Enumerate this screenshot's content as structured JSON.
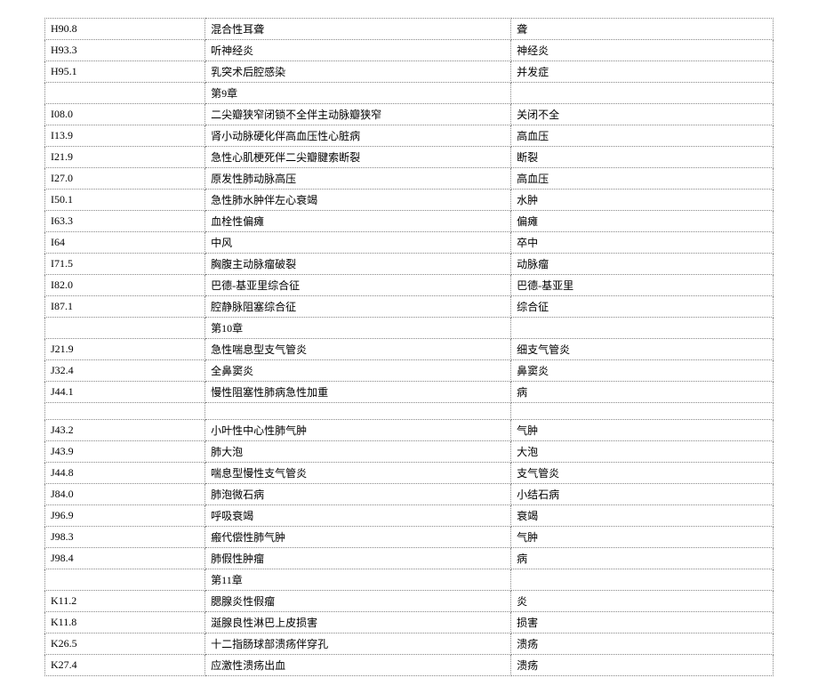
{
  "rows": [
    {
      "code": "H90.8",
      "description": "混合性耳聋",
      "keyword": "聋"
    },
    {
      "code": "H93.3",
      "description": "听神经炎",
      "keyword": "神经炎"
    },
    {
      "code": "H95.1",
      "description": "乳突术后腔感染",
      "keyword": "并发症"
    },
    {
      "code": "",
      "description": "第9章",
      "keyword": ""
    },
    {
      "code": "I08.0",
      "description": "二尖瓣狭窄闭锁不全伴主动脉瓣狭窄",
      "keyword": "关闭不全"
    },
    {
      "code": "I13.9",
      "description": "肾小动脉硬化伴高血压性心脏病",
      "keyword": "高血压"
    },
    {
      "code": "I21.9",
      "description": "急性心肌梗死伴二尖瓣腱索断裂",
      "keyword": "断裂"
    },
    {
      "code": "I27.0",
      "description": "原发性肺动脉高压",
      "keyword": "高血压"
    },
    {
      "code": "I50.1",
      "description": "急性肺水肿伴左心衰竭",
      "keyword": "水肿"
    },
    {
      "code": "I63.3",
      "description": "血栓性偏瘫",
      "keyword": "偏瘫"
    },
    {
      "code": "I64",
      "description": "中风",
      "keyword": "卒中"
    },
    {
      "code": "I71.5",
      "description": "胸腹主动脉瘤破裂",
      "keyword": "动脉瘤"
    },
    {
      "code": "I82.0",
      "description": "巴德-基亚里综合征",
      "keyword": "巴德-基亚里"
    },
    {
      "code": "I87.1",
      "description": "腔静脉阻塞综合征",
      "keyword": "综合征"
    },
    {
      "code": "",
      "description": "第10章",
      "keyword": ""
    },
    {
      "code": "J21.9",
      "description": "急性喘息型支气管炎",
      "keyword": "细支气管炎"
    },
    {
      "code": "J32.4",
      "description": "全鼻窦炎",
      "keyword": "鼻窦炎"
    },
    {
      "code": "J44.1",
      "description": "慢性阻塞性肺病急性加重",
      "keyword": "病"
    },
    {
      "code": "",
      "description": "",
      "keyword": ""
    },
    {
      "code": "J43.2",
      "description": "小叶性中心性肺气肿",
      "keyword": "气肿"
    },
    {
      "code": "J43.9",
      "description": "肺大泡",
      "keyword": "大泡"
    },
    {
      "code": "J44.8",
      "description": "喘息型慢性支气管炎",
      "keyword": "支气管炎"
    },
    {
      "code": "J84.0",
      "description": "肺泡微石病",
      "keyword": "小结石病"
    },
    {
      "code": "J96.9",
      "description": "呼吸衰竭",
      "keyword": "衰竭"
    },
    {
      "code": "J98.3",
      "description": "瘢代偿性肺气肿",
      "keyword": "气肿"
    },
    {
      "code": "J98.4",
      "description": "肺假性肿瘤",
      "keyword": "病"
    },
    {
      "code": "",
      "description": "第11章",
      "keyword": ""
    },
    {
      "code": "K11.2",
      "description": "腮腺炎性假瘤",
      "keyword": "炎"
    },
    {
      "code": "K11.8",
      "description": "涎腺良性淋巴上皮损害",
      "keyword": "损害"
    },
    {
      "code": "K26.5",
      "description": "十二指肠球部溃疡伴穿孔",
      "keyword": "溃疡"
    },
    {
      "code": "K27.4",
      "description": "应激性溃疡出血",
      "keyword": "溃疡"
    }
  ]
}
